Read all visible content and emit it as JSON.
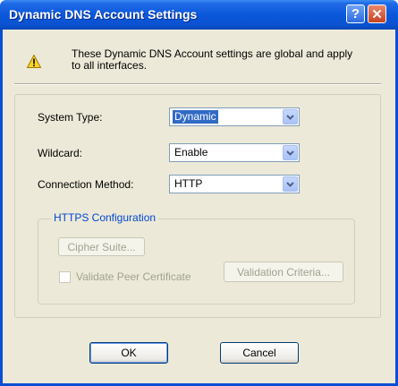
{
  "window": {
    "title": "Dynamic DNS Account Settings",
    "help_label": "?",
    "close_label": "✕"
  },
  "notice": {
    "text": "These Dynamic DNS Account settings are global and apply to all interfaces."
  },
  "form": {
    "system_type": {
      "label": "System Type:",
      "value": "Dynamic"
    },
    "wildcard": {
      "label": "Wildcard:",
      "value": "Enable"
    },
    "connection_method": {
      "label": "Connection Method:",
      "value": "HTTP"
    }
  },
  "https": {
    "title": "HTTPS Configuration",
    "cipher_suite_label": "Cipher Suite...",
    "validate_label": "Validate Peer Certificate",
    "validate_checked": false,
    "validation_criteria_label": "Validation Criteria..."
  },
  "footer": {
    "ok_label": "OK",
    "cancel_label": "Cancel"
  },
  "colors": {
    "titlebar": "#0a52d0",
    "accent_group_title": "#0046d5",
    "selection": "#316ac5"
  }
}
